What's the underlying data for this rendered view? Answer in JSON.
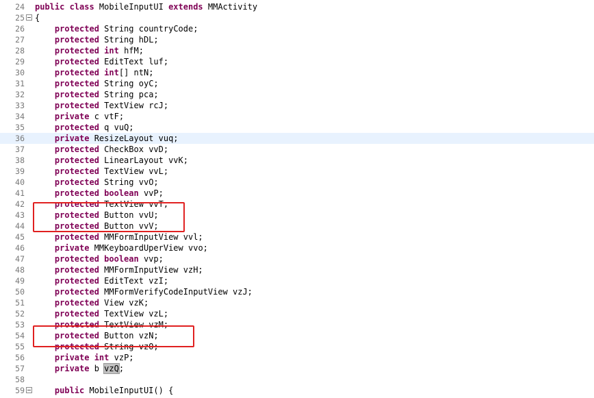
{
  "editor": {
    "lines": [
      {
        "n": "24",
        "indent": "",
        "kw": "public class",
        "type": " MobileInputUI ",
        "kw2": "extends",
        "name": " MMActivity",
        "fold": false
      },
      {
        "n": "25",
        "indent": "",
        "kw": "",
        "type": "{",
        "kw2": "",
        "name": "",
        "fold": true
      },
      {
        "n": "26",
        "indent": "    ",
        "kw": "protected",
        "type": " String",
        "kw2": "",
        "name": " countryCode;",
        "fold": false
      },
      {
        "n": "27",
        "indent": "    ",
        "kw": "protected",
        "type": " String",
        "kw2": "",
        "name": " hDL;",
        "fold": false
      },
      {
        "n": "28",
        "indent": "    ",
        "kw": "protected",
        "type": "",
        "kw2": " int",
        "name": " hfM;",
        "fold": false
      },
      {
        "n": "29",
        "indent": "    ",
        "kw": "protected",
        "type": " EditText",
        "kw2": "",
        "name": " luf;",
        "fold": false
      },
      {
        "n": "30",
        "indent": "    ",
        "kw": "protected",
        "type": "",
        "kw2": " int",
        "name": "[] ntN;",
        "fold": false
      },
      {
        "n": "31",
        "indent": "    ",
        "kw": "protected",
        "type": " String",
        "kw2": "",
        "name": " oyC;",
        "fold": false
      },
      {
        "n": "32",
        "indent": "    ",
        "kw": "protected",
        "type": " String",
        "kw2": "",
        "name": " pca;",
        "fold": false
      },
      {
        "n": "33",
        "indent": "    ",
        "kw": "protected",
        "type": " TextView",
        "kw2": "",
        "name": " rcJ;",
        "fold": false
      },
      {
        "n": "34",
        "indent": "    ",
        "kw": "private",
        "type": " c",
        "kw2": "",
        "name": " vtF;",
        "fold": false
      },
      {
        "n": "35",
        "indent": "    ",
        "kw": "protected",
        "type": " q",
        "kw2": "",
        "name": " vuQ;",
        "fold": false
      },
      {
        "n": "36",
        "indent": "    ",
        "kw": "private",
        "type": " ResizeLayout",
        "kw2": "",
        "name": " vuq;",
        "fold": false,
        "current": true
      },
      {
        "n": "37",
        "indent": "    ",
        "kw": "protected",
        "type": " CheckBox",
        "kw2": "",
        "name": " vvD;",
        "fold": false
      },
      {
        "n": "38",
        "indent": "    ",
        "kw": "protected",
        "type": " LinearLayout",
        "kw2": "",
        "name": " vvK;",
        "fold": false
      },
      {
        "n": "39",
        "indent": "    ",
        "kw": "protected",
        "type": " TextView",
        "kw2": "",
        "name": " vvL;",
        "fold": false
      },
      {
        "n": "40",
        "indent": "    ",
        "kw": "protected",
        "type": " String",
        "kw2": "",
        "name": " vvO;",
        "fold": false
      },
      {
        "n": "41",
        "indent": "    ",
        "kw": "protected",
        "type": "",
        "kw2": " boolean",
        "name": " vvP;",
        "fold": false
      },
      {
        "n": "42",
        "indent": "    ",
        "kw": "protected",
        "type": " TextView",
        "kw2": "",
        "name": " vvT;",
        "fold": false
      },
      {
        "n": "43",
        "indent": "    ",
        "kw": "protected",
        "type": " Button",
        "kw2": "",
        "name": " vvU;",
        "fold": false
      },
      {
        "n": "44",
        "indent": "    ",
        "kw": "protected",
        "type": " Button",
        "kw2": "",
        "name": " vvV;",
        "fold": false
      },
      {
        "n": "45",
        "indent": "    ",
        "kw": "protected",
        "type": " MMFormInputView",
        "kw2": "",
        "name": " vvl;",
        "fold": false
      },
      {
        "n": "46",
        "indent": "    ",
        "kw": "private",
        "type": " MMKeyboardUperView",
        "kw2": "",
        "name": " vvo;",
        "fold": false
      },
      {
        "n": "47",
        "indent": "    ",
        "kw": "protected",
        "type": "",
        "kw2": " boolean",
        "name": " vvp;",
        "fold": false
      },
      {
        "n": "48",
        "indent": "    ",
        "kw": "protected",
        "type": " MMFormInputView",
        "kw2": "",
        "name": " vzH;",
        "fold": false
      },
      {
        "n": "49",
        "indent": "    ",
        "kw": "protected",
        "type": " EditText",
        "kw2": "",
        "name": " vzI;",
        "fold": false
      },
      {
        "n": "50",
        "indent": "    ",
        "kw": "protected",
        "type": " MMFormVerifyCodeInputView",
        "kw2": "",
        "name": " vzJ;",
        "fold": false
      },
      {
        "n": "51",
        "indent": "    ",
        "kw": "protected",
        "type": " View",
        "kw2": "",
        "name": " vzK;",
        "fold": false
      },
      {
        "n": "52",
        "indent": "    ",
        "kw": "protected",
        "type": " TextView",
        "kw2": "",
        "name": " vzL;",
        "fold": false
      },
      {
        "n": "53",
        "indent": "    ",
        "kw": "protected",
        "type": " TextView",
        "kw2": "",
        "name": " vzM;",
        "fold": false
      },
      {
        "n": "54",
        "indent": "    ",
        "kw": "protected",
        "type": " Button",
        "kw2": "",
        "name": " vzN;",
        "fold": false
      },
      {
        "n": "55",
        "indent": "    ",
        "kw": "protected",
        "type": " String",
        "kw2": "",
        "name": " vzO;",
        "fold": false
      },
      {
        "n": "56",
        "indent": "    ",
        "kw": "private",
        "type": "",
        "kw2": " int",
        "name": " vzP;",
        "fold": false
      },
      {
        "n": "57",
        "indent": "    ",
        "kw": "private",
        "type": " b",
        "kw2": "",
        "name": " ",
        "hl": "vzQ",
        "tail": ";",
        "fold": false
      },
      {
        "n": "58",
        "indent": "",
        "kw": "",
        "type": "",
        "kw2": "",
        "name": "",
        "fold": false
      },
      {
        "n": "59",
        "indent": "    ",
        "kw": "public",
        "type": " MobileInputUI() {",
        "kw2": "",
        "name": "",
        "fold": true
      }
    ]
  },
  "colors": {
    "keyword": "#7f0055",
    "line_number": "#787878",
    "current_line": "#e8f2fe",
    "annotation_box": "#e02020"
  }
}
